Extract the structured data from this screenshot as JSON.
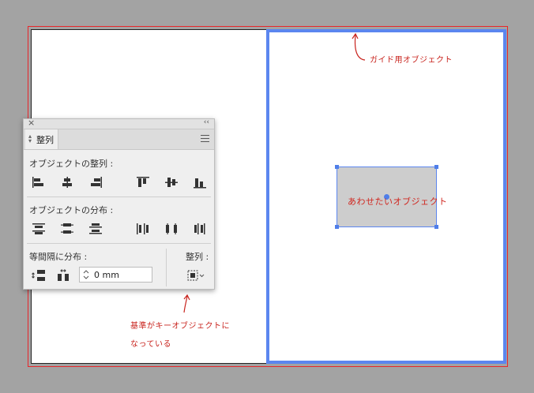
{
  "panel": {
    "tab_label": "整列",
    "close_glyph": "×",
    "collapse_glyph": "‹‹",
    "sections": {
      "align_objects": "オブジェクトの整列 :",
      "distribute_objects": "オブジェクトの分布 :",
      "distribute_spacing": "等間隔に分布 :",
      "align_to": "整列 :"
    },
    "spacing_value": "0 mm"
  },
  "canvas": {
    "object_label": "あわせたいオブジェクト",
    "guide_note": "ガイド用オブジェクト",
    "key_note_line1": "基準がキーオブジェクトに",
    "key_note_line2": "なっている"
  },
  "colors": {
    "background": "#a3a3a3",
    "selection_blue": "#5b86ef",
    "bleed_red": "#e8262b",
    "annotation_red": "#c8231d"
  }
}
